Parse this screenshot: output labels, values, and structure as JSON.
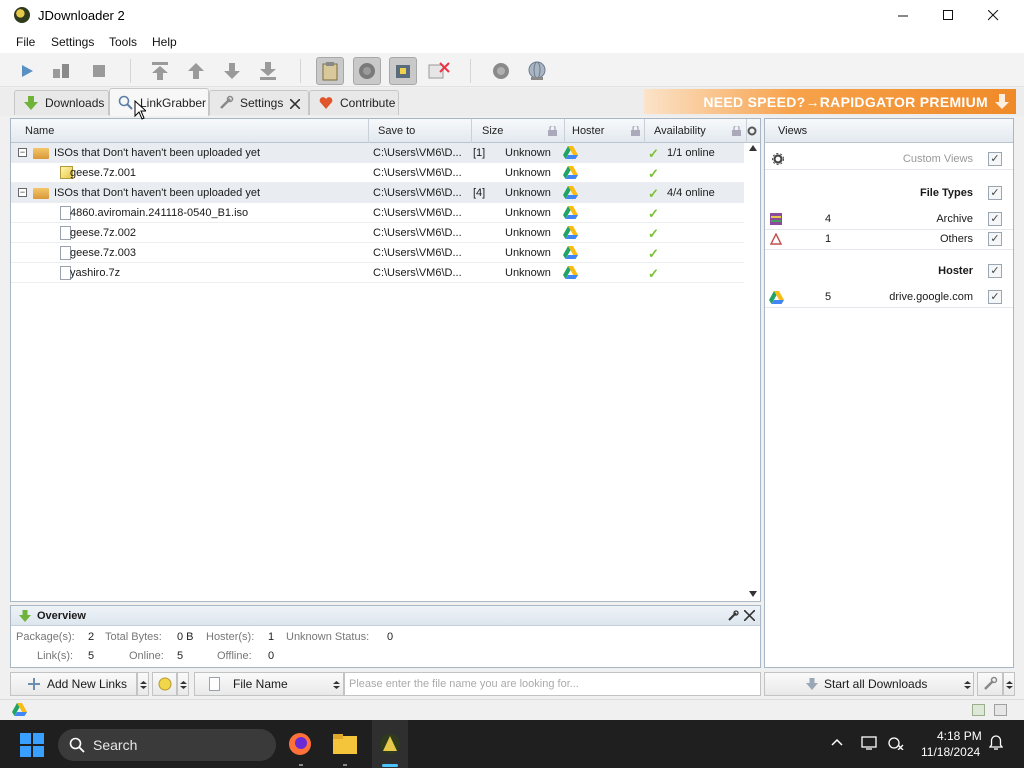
{
  "window": {
    "title": "JDownloader 2"
  },
  "menu": [
    "File",
    "Settings",
    "Tools",
    "Help"
  ],
  "tabs": {
    "downloads": "Downloads",
    "linkgrabber": "LinkGrabber",
    "settings": "Settings",
    "contribute": "Contribute"
  },
  "promo": "NEED SPEED?→RAPIDGATOR PREMIUM",
  "table": {
    "headers": {
      "name": "Name",
      "save_to": "Save to",
      "size": "Size",
      "hoster": "Hoster",
      "availability": "Availability"
    },
    "rows": [
      {
        "name": "ISOs that Don't haven't been uploaded yet",
        "save_to": "C:\\Users\\VM6\\D...",
        "count": "[1]",
        "size": "Unknown",
        "availability": "1/1 online"
      },
      {
        "name": "geese.7z.001",
        "save_to": "C:\\Users\\VM6\\D...",
        "size": "Unknown"
      },
      {
        "name": "ISOs that Don't haven't been uploaded yet",
        "save_to": "C:\\Users\\VM6\\D...",
        "count": "[4]",
        "size": "Unknown",
        "availability": "4/4 online"
      },
      {
        "name": "4860.aviromain.241118-0540_B1.iso",
        "save_to": "C:\\Users\\VM6\\D...",
        "size": "Unknown"
      },
      {
        "name": "geese.7z.002",
        "save_to": "C:\\Users\\VM6\\D...",
        "size": "Unknown"
      },
      {
        "name": "geese.7z.003",
        "save_to": "C:\\Users\\VM6\\D...",
        "size": "Unknown"
      },
      {
        "name": "yashiro.7z",
        "save_to": "C:\\Users\\VM6\\D...",
        "size": "Unknown"
      }
    ]
  },
  "overview": {
    "title": "Overview",
    "packages_label": "Package(s):",
    "packages": "2",
    "total_bytes_label": "Total Bytes:",
    "total_bytes": "0 B",
    "hosters_label": "Hoster(s):",
    "hosters": "1",
    "unknown_status_label": "Unknown Status:",
    "unknown_status": "0",
    "links_label": "Link(s):",
    "links": "5",
    "online_label": "Online:",
    "online": "5",
    "offline_label": "Offline:",
    "offline": "0"
  },
  "views": {
    "title": "Views",
    "custom_views": "Custom Views",
    "file_types": "File Types",
    "archive_count": "4",
    "archive": "Archive",
    "others_count": "1",
    "others": "Others",
    "hoster": "Hoster",
    "drive_count": "5",
    "drive": "drive.google.com"
  },
  "bottom": {
    "add_new_links": "Add New Links",
    "file_name": "File Name",
    "search_placeholder": "Please enter the file name you are looking for...",
    "start_all": "Start all Downloads"
  },
  "taskbar": {
    "search": "Search",
    "time": "4:18 PM",
    "date": "11/18/2024"
  },
  "colors": {
    "accent_check": "#7bbf33",
    "promo": "#f08a28"
  }
}
